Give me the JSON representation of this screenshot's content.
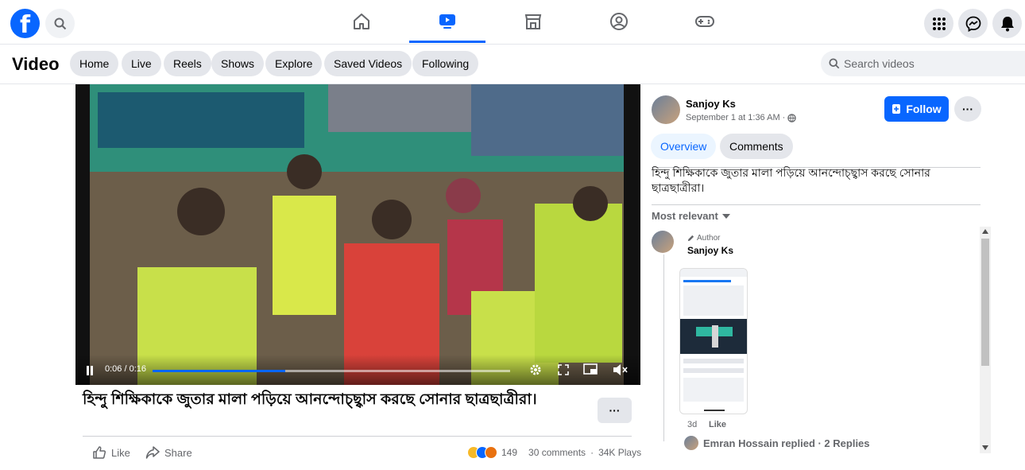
{
  "header": {
    "logo": "f",
    "nav": [
      "home-icon",
      "video-icon",
      "marketplace-icon",
      "groups-icon",
      "gaming-icon"
    ],
    "active_tab": "video-icon"
  },
  "subnav": {
    "title": "Video",
    "chips": [
      "Home",
      "Live",
      "Reels",
      "Shows",
      "Explore",
      "Saved Videos",
      "Following"
    ],
    "search_placeholder": "Search videos"
  },
  "player": {
    "time": "0:06 / 0:16",
    "progress": 0.37
  },
  "post": {
    "caption": "হিন্দু শিক্ষিকাকে জুতার মালা পড়িয়ে আনন্দোচ্ছ্বাস করছে সোনার ছাত্রছাত্রীরা।",
    "more_label": "···",
    "like_label": "Like",
    "share_label": "Share",
    "reactions_count": "149",
    "comments": "30 comments",
    "plays": "34K Plays"
  },
  "sidebar": {
    "author": "Sanjoy Ks",
    "date": "September 1 at 1:36 AM ·",
    "follow_label": "Follow",
    "tabs": [
      "Overview",
      "Comments"
    ],
    "description": "হিন্দু শিক্ষিকাকে জুতার মালা পড়িয়ে আনন্দোচ্ছ্বাস করছে সোনার ছাত্রছাত্রীরা।",
    "sort_label": "Most relevant",
    "comment": {
      "badge": "Author",
      "name": "Sanjoy Ks",
      "age": "3d",
      "like": "Like",
      "replies": "Emran Hossain replied · 2 Replies"
    }
  },
  "colors": {
    "brand": "#0866ff",
    "chip_bg": "#e4e6eb",
    "muted": "#65676b"
  }
}
